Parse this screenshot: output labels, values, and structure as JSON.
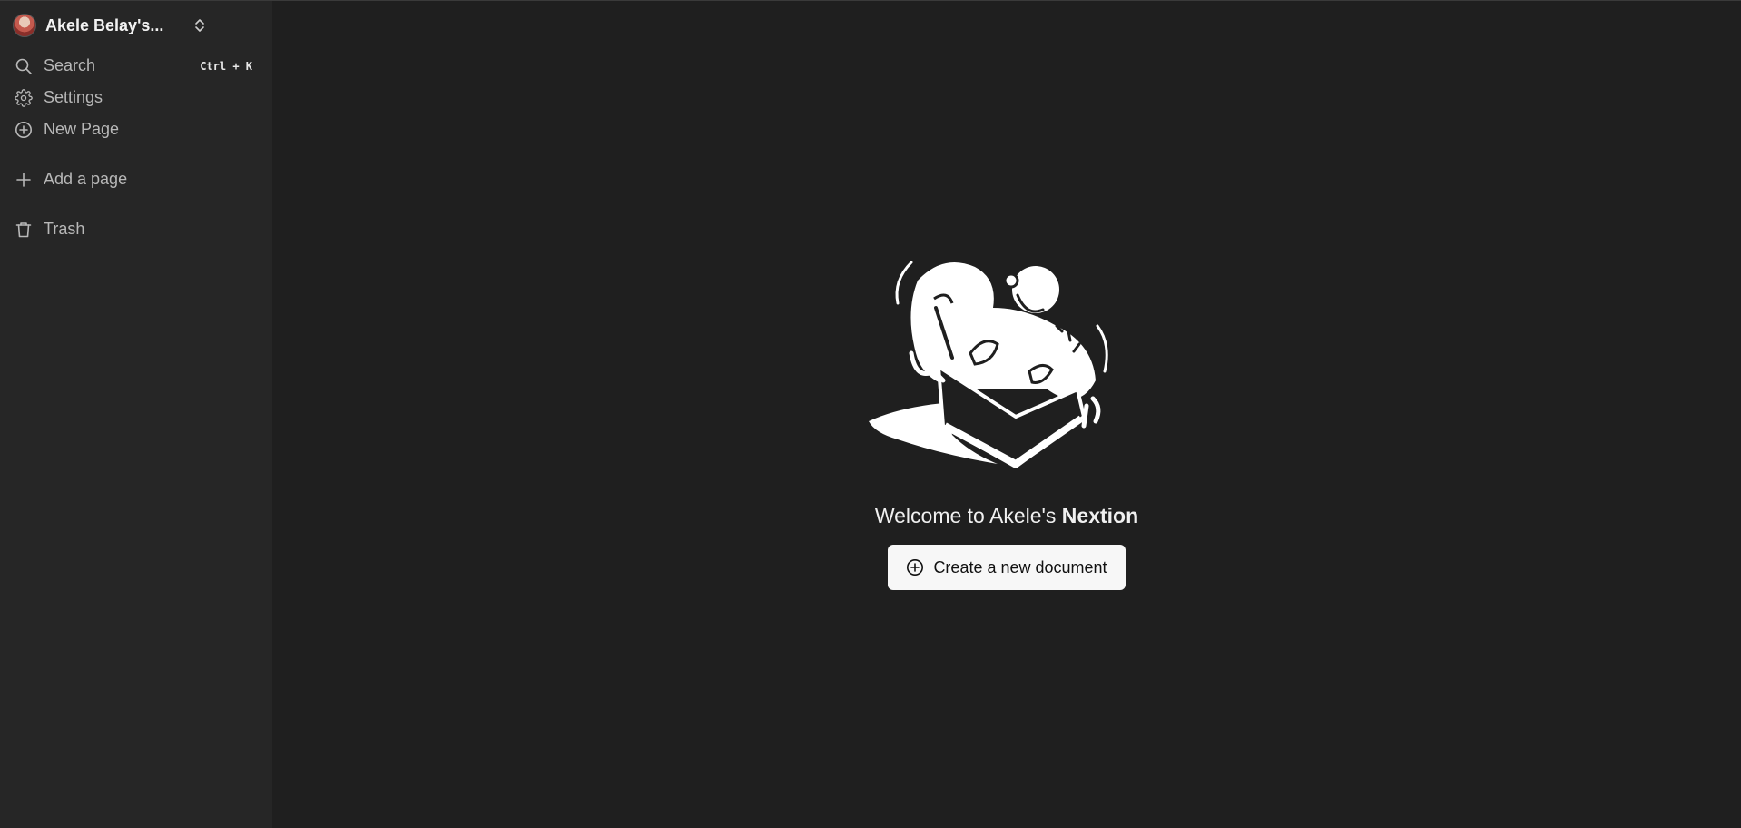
{
  "sidebar": {
    "workspace": {
      "name": "Akele Belay's...",
      "avatar_icon": "user-avatar",
      "switcher_icon": "chevron-up-down-icon"
    },
    "items": [
      {
        "label": "Search",
        "icon": "search-icon",
        "shortcut": "Ctrl + K"
      },
      {
        "label": "Settings",
        "icon": "gear-icon"
      },
      {
        "label": "New Page",
        "icon": "plus-circle-icon"
      },
      {
        "label": "Add a page",
        "icon": "plus-icon"
      },
      {
        "label": "Trash",
        "icon": "trash-icon"
      }
    ]
  },
  "main": {
    "illustration": "person-with-documents-box-illustration",
    "welcome_prefix": "Welcome to Akele's ",
    "welcome_brand": "Nextion",
    "create_button": {
      "label": "Create a new document",
      "icon": "plus-circle-icon"
    }
  },
  "colors": {
    "sidebar_bg": "#262626",
    "main_bg": "#1f1f1f",
    "button_bg": "#f7f7f7",
    "text_primary": "#f0f0f0",
    "text_muted": "#b8b8b8"
  }
}
